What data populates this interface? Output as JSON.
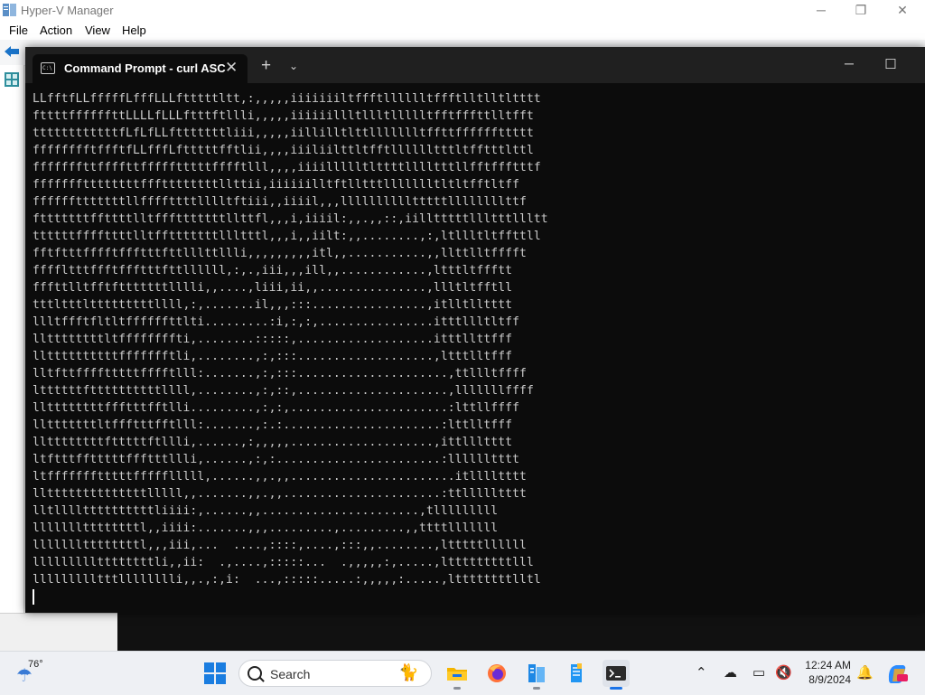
{
  "hyperv": {
    "title": "Hyper-V Manager",
    "menu": [
      "File",
      "Action",
      "View",
      "Help"
    ],
    "controls": {
      "minimize": "─",
      "maximize": "❐",
      "close": "✕"
    }
  },
  "terminal": {
    "tab_title": "Command Prompt - curl  ASC",
    "tab_icon_text": "C:\\",
    "tab_close": "✕",
    "new_tab": "+",
    "dropdown": "⌄",
    "controls": {
      "minimize": "─",
      "maximize": "☐",
      "close": "✕"
    },
    "lines": [
      "LLfftfLLfffffLfffLLLftttttltt,:,,,,,iiiiiiiltffftlllllltffftlltlltltttt",
      "fttttffffffttLLLLfLLLftttftllli,,,,,iiiiiillltllltllllltfftfffttlltfft",
      "ttttttttttttfLfLfLLftttttttliii,,,,,iillilltlttllllllltffttffffffttttt",
      "fffffffftffftfLLfffLftttttfftlii,,,,iiiliilttltfftlllllltttltfftttlttl",
      "fffffffttffffttffffftttttfffftlll,,,,iiiillllltlttttlllltttllfftffftttf",
      "fffffffttttttttfffttttttttllttii,iiiiiilltftlltttllllllltltltfftltff",
      "fffffftttttttllffffttttlllltftiii,,iiiil,,,lllllllllltttttllllllllttf",
      "ftttttttffttttlltffftttttttllttfl,,,i,iiiil:,,.,,::,iilltttttllltttllltt",
      "ttttttffffttttlltfftttttttllltttl,,,i,,iilt:,,........,:,ltllltltffttll",
      "fftftttfffftffftttfttlllttllli,,,,,,,,,itl,,...........,,llttlltfffft",
      "ffffltttffftffftttfttllllll,:,.,iii,,,ill,,............,ltttltffftt",
      "fffttlltfftftttttttlllli,,....,liii,ii,,...............,llltltfftll",
      "tttltttltttttttttllll,:,.......il,,,:::................,itlltlltttt",
      "llltffftfltltffffffttlti.........:i,:,:,................itttllltltff",
      "llttttttttltffffffffti,........:::::,...................itttllttfff",
      "llttttttttttffffffftli,........,:,:::...................,ltttlltfff",
      "lltfttfffftttttfffftlll:.......,:,:::.....................,ttllltffff",
      "lttttttfttttttttttllll,........,:,::,.....................,lllllllffff",
      "llttttttttffftttfftlli.........,:,:,......................:lttllffff",
      "lltttttttltffftttfftlll:.......,:.:......................:lttlltfff",
      "llttttttttftttttftllli,......,:,,,,,....................,ittllltttt",
      "ltftttfftttttffftttllli,......,:,:.......................:lllllltttt",
      "ltffffffftttttffffflllll,......,,.,,.......................itlllltttt",
      "llttttttttttttttlllll,,.......,,.,,......................:ttllllltttt",
      "lltllllttttttttttliiii:,......,,......................,tlllllllll",
      "lllllllttttttttl,,iiii:.......,,,.........,.........,,ttttlllllll",
      "lllllllttttttttl,,,iii,...  ....,::::,....,:::,,........,ltttttllllll",
      "lllllllllttttttttli,,ii:  .,....,:::::...  .,,,,,:,.....,ltttttttttlll",
      "llllllllltttlllllllli,,.,:,i:  ...,:::::.....:,,,,,:.....,lttttttttlltl"
    ]
  },
  "taskbar": {
    "weather_temp": "76°",
    "weather_icon": "weather-icon",
    "search_placeholder": "Search",
    "search_deco": "🐈",
    "time": "12:24 AM",
    "date": "8/9/2024"
  }
}
